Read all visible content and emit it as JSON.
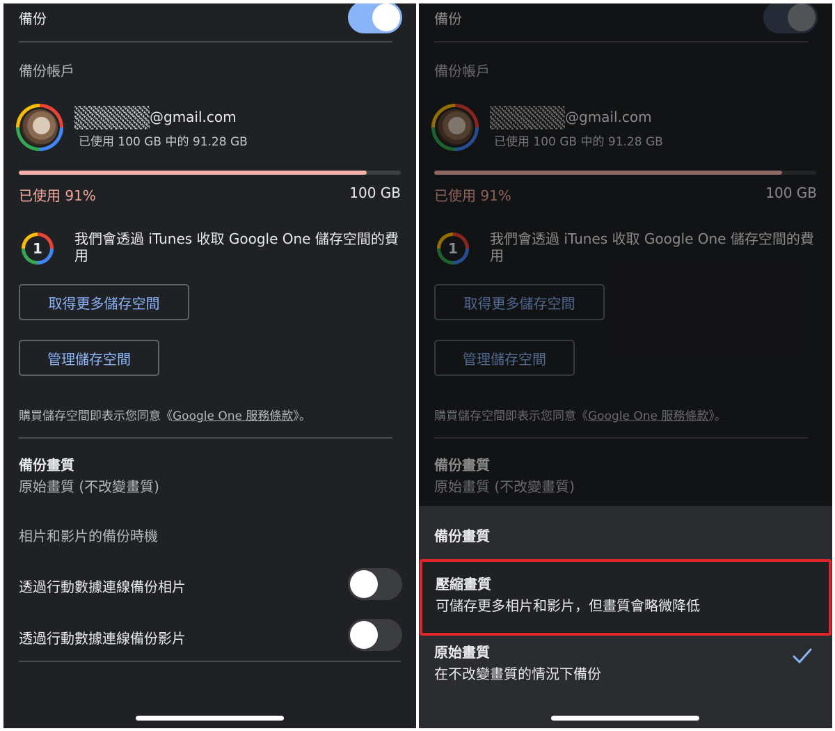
{
  "left_panel": {
    "backup_label": "備份",
    "backup_account_label": "備份帳戶",
    "account": {
      "email_suffix": "@gmail.com",
      "usage_text": "已使用 100 GB 中的 91.28 GB"
    },
    "storage": {
      "used_fraction": 0.91,
      "used_percent_text": "已使用 91%",
      "total_text": "100 GB"
    },
    "google_one_notice": "我們會透過 iTunes 收取 Google One 儲存空間的費用",
    "google_one_badge": "1",
    "buttons": {
      "get_more_storage": "取得更多儲存空間",
      "manage_storage": "管理儲存空間"
    },
    "terms": {
      "prefix": "購買儲存空間即表示您同意《",
      "link": "Google One 服務條款",
      "suffix": "》。"
    },
    "backup_quality": {
      "title": "備份畫質",
      "value": "原始畫質 (不改變畫質)"
    },
    "backup_timing_label": "相片和影片的備份時機",
    "toggles": {
      "backup_toggle_on": true,
      "cellular_photos_label": "透過行動數據連線備份相片",
      "cellular_photos_on": false,
      "cellular_videos_label": "透過行動數據連線備份影片",
      "cellular_videos_on": false
    }
  },
  "right_panel": {
    "background_copy": "same as left panel, dimmed",
    "sheet": {
      "title": "備份畫質",
      "options": [
        {
          "title": "壓縮畫質",
          "description": "可儲存更多相片和影片，但畫質會略微降低",
          "selected": false,
          "highlighted": true
        },
        {
          "title": "原始畫質",
          "description": "在不改變畫質的情況下備份",
          "selected": true,
          "highlighted": false
        }
      ]
    }
  },
  "colors": {
    "background": "#202124",
    "accent_blue": "#8ab4f8",
    "usage_pink": "#f2a89d",
    "highlight_red": "#e0262b"
  }
}
